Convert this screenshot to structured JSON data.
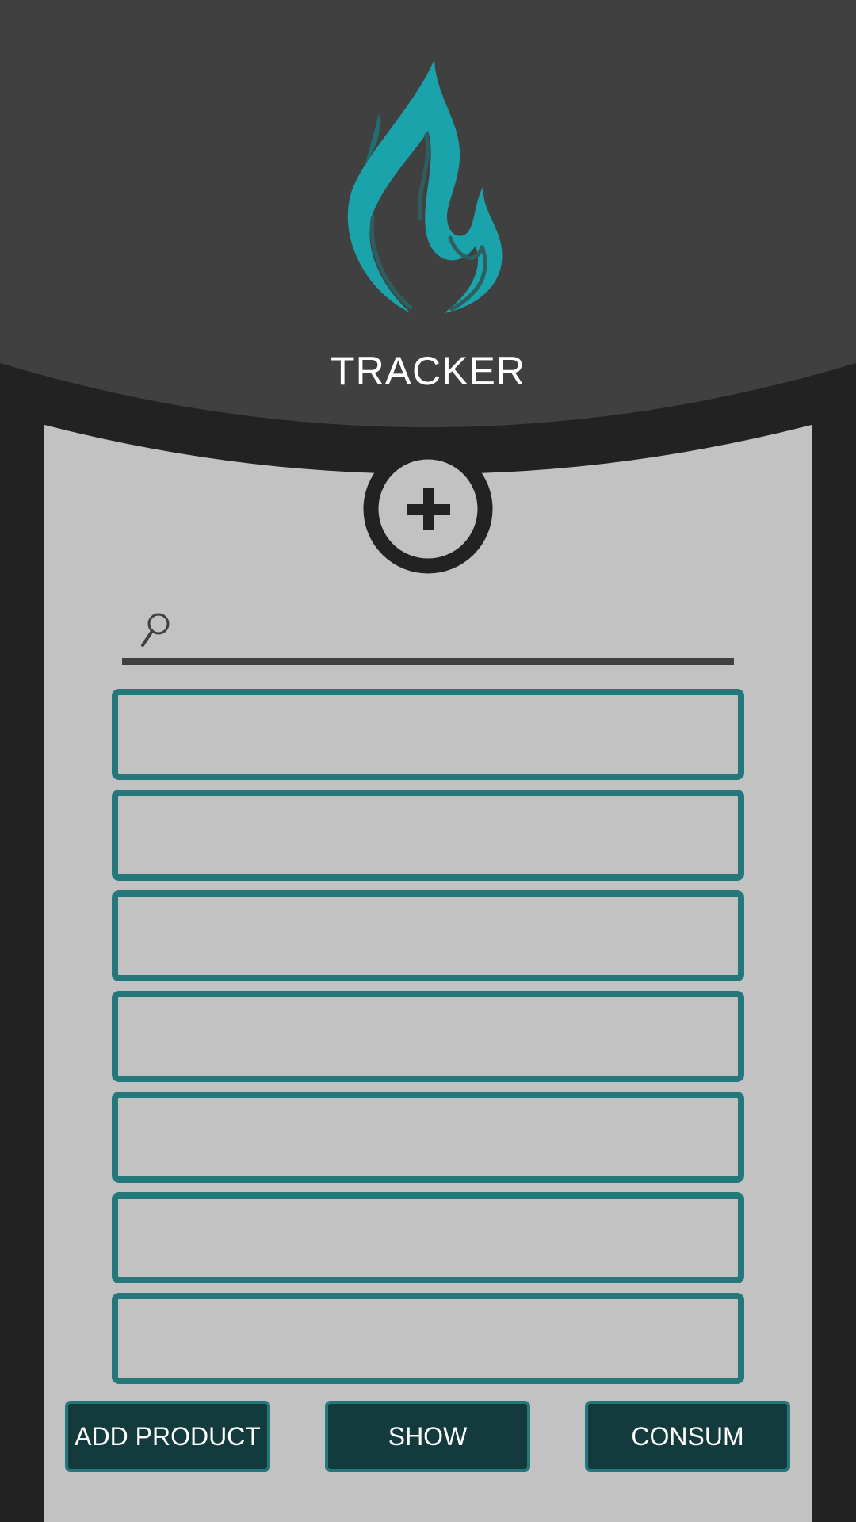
{
  "app": {
    "title": "TRACKER",
    "logo_icon": "flame-icon",
    "add_icon": "plus-icon"
  },
  "search": {
    "icon": "search-icon",
    "value": "",
    "placeholder": ""
  },
  "products": [
    {
      "label": ""
    },
    {
      "label": ""
    },
    {
      "label": ""
    },
    {
      "label": ""
    },
    {
      "label": ""
    },
    {
      "label": ""
    },
    {
      "label": ""
    }
  ],
  "buttons": {
    "add_product": "ADD PRODUCT",
    "show": "SHOW",
    "consum": "CONSUM"
  },
  "colors": {
    "header": "#404040",
    "frame": "#222222",
    "panel": "#c2c2c2",
    "accent": "#24777a",
    "button_fill": "#133a3d",
    "flame": "#1aa3ab"
  }
}
